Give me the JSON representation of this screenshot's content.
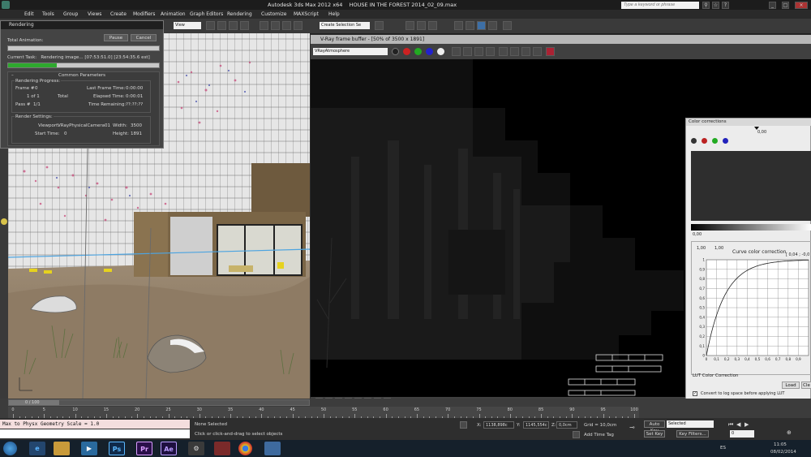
{
  "window": {
    "app_title": "Autodesk 3ds Max  2012 x64",
    "file_title": "HOUSE IN THE FOREST 2014_02_09.max",
    "search_placeholder": "Type a keyword or phrase"
  },
  "menu": [
    "Edit",
    "Tools",
    "Group",
    "Views",
    "Create",
    "Modifiers",
    "Animation",
    "Graph Editors",
    "Rendering",
    "Customize",
    "MAXScript",
    "Help"
  ],
  "toolbar": {
    "view_dropdown": "View",
    "selection_set": "Create Selection Se"
  },
  "rendering_dialog": {
    "title": "Rendering",
    "total_animation_label": "Total Animation:",
    "pause_label": "Pause",
    "cancel_label": "Cancel",
    "current_task_label": "Current Task:",
    "current_task_value": "Rendering image... [07:53:51.0] [23:54:35.6 est]",
    "current_progress": 0.32,
    "total_progress": 0.0,
    "section_title": "Common Parameters",
    "progress_header": "Rendering Progress:",
    "frame_label": "Frame #",
    "frame_value": "0",
    "of_value": "1 of  1",
    "total_label": "Total",
    "pass_label": "Pass #",
    "pass_value": "1/1",
    "last_frame_time_label": "Last Frame Time:",
    "last_frame_time_value": "0:00:00",
    "elapsed_time_label": "Elapsed Time:",
    "elapsed_time_value": "0:00:01",
    "time_remaining_label": "Time Remaining:",
    "time_remaining_value": "??:??:??",
    "settings_header": "Render Settings:",
    "viewport_label": "Viewport:",
    "viewport_value": "VRayPhysicalCamera01",
    "width_label": "Width:",
    "width_value": "3500",
    "start_time_label": "Start Time:",
    "start_time_value": "0",
    "height_label": "Height:",
    "height_value": "1891"
  },
  "vfb": {
    "title": "V-Ray frame buffer - [50% of 3500 x 1891]",
    "channel": "VRayAtmosphere"
  },
  "color_corrections": {
    "title": "Color corrections",
    "top_value": "0,00",
    "bottom_value": "0,00",
    "curve_title": "Curve color correction",
    "coord_left": "1,00",
    "coord_right": "1,00",
    "coord_readout": "[ 0,04 ; -0,0",
    "y_ticks": [
      "1",
      "0,9",
      "0,8",
      "0,7",
      "0,6",
      "0,5",
      "0,4",
      "0,3",
      "0,2",
      "0,1",
      "0"
    ],
    "x_ticks": [
      "0",
      "0,1",
      "0,2",
      "0,3",
      "0,4",
      "0,5",
      "0,6",
      "0,7",
      "0,8",
      "0,9"
    ],
    "lut_label": "LUT Color Correction",
    "load_label": "Load",
    "clear_label": "Cle",
    "log_space_label": "Convert to log space before applying LUT"
  },
  "timeline": {
    "frame_counter": "0 / 100",
    "ticks": [
      "0",
      "5",
      "10",
      "15",
      "20",
      "25",
      "30",
      "35",
      "40",
      "45",
      "50",
      "55",
      "60",
      "65",
      "70",
      "75",
      "80",
      "85",
      "90",
      "95",
      "100"
    ]
  },
  "status": {
    "script_line": "Max to Physx Geometry Scale = 1.0",
    "selection": "None Selected",
    "prompt": "Click or click-and-drag to select objects",
    "x_label": "X:",
    "x_value": "1138,898c",
    "y_label": "Y:",
    "y_value": "1145,554c",
    "z_label": "Z:",
    "z_value": "0,0cm",
    "grid": "Grid = 10,0cm",
    "add_time_tag": "Add Time Tag",
    "auto_key": "Auto Key",
    "set_key": "Set Key",
    "key_mode": "Selected",
    "key_filters": "Key Filters...",
    "frame_field": "0"
  },
  "taskbar": {
    "language": "ES",
    "time": "11:05",
    "date": "08/02/2014",
    "apps": [
      "Ps",
      "Pr",
      "Ae"
    ]
  }
}
